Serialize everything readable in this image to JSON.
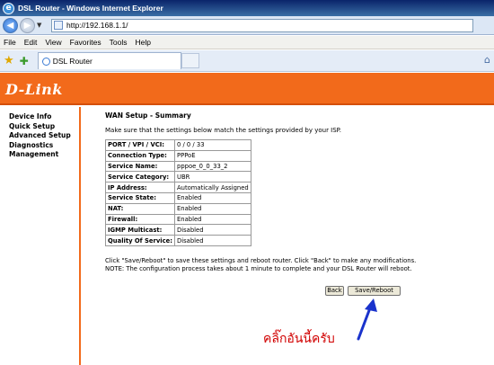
{
  "window": {
    "title": "DSL Router - Windows Internet Explorer"
  },
  "address": {
    "url": "http://192.168.1.1/"
  },
  "menu": [
    "File",
    "Edit",
    "View",
    "Favorites",
    "Tools",
    "Help"
  ],
  "tab": {
    "label": "DSL Router"
  },
  "router": {
    "logo": "D-Link",
    "nav": [
      "Device Info",
      "Quick Setup",
      "Advanced Setup",
      "Diagnostics",
      "Management"
    ],
    "heading": "WAN Setup - Summary",
    "intro": "Make sure that the settings below match the settings provided by your ISP.",
    "rows": [
      {
        "k": "PORT / VPI / VCI:",
        "v": "0 / 0 / 33"
      },
      {
        "k": "Connection Type:",
        "v": "PPPoE"
      },
      {
        "k": "Service Name:",
        "v": "pppoe_0_0_33_2"
      },
      {
        "k": "Service Category:",
        "v": "UBR"
      },
      {
        "k": "IP Address:",
        "v": "Automatically Assigned"
      },
      {
        "k": "Service State:",
        "v": "Enabled"
      },
      {
        "k": "NAT:",
        "v": "Enabled"
      },
      {
        "k": "Firewall:",
        "v": "Enabled"
      },
      {
        "k": "IGMP Multicast:",
        "v": "Disabled"
      },
      {
        "k": "Quality Of Service:",
        "v": "Disabled"
      }
    ],
    "note_line1": "Click \"Save/Reboot\" to save these settings and reboot router. Click \"Back\" to make any modifications.",
    "note_line2": "NOTE: The configuration process takes about 1 minute to complete and your DSL Router will reboot.",
    "back_label": "Back",
    "save_label": "Save/Reboot"
  },
  "annotation": {
    "text": "คลิ๊กอันนี้ครับ",
    "color": "#d10000",
    "arrow_color": "#1a33cc"
  }
}
